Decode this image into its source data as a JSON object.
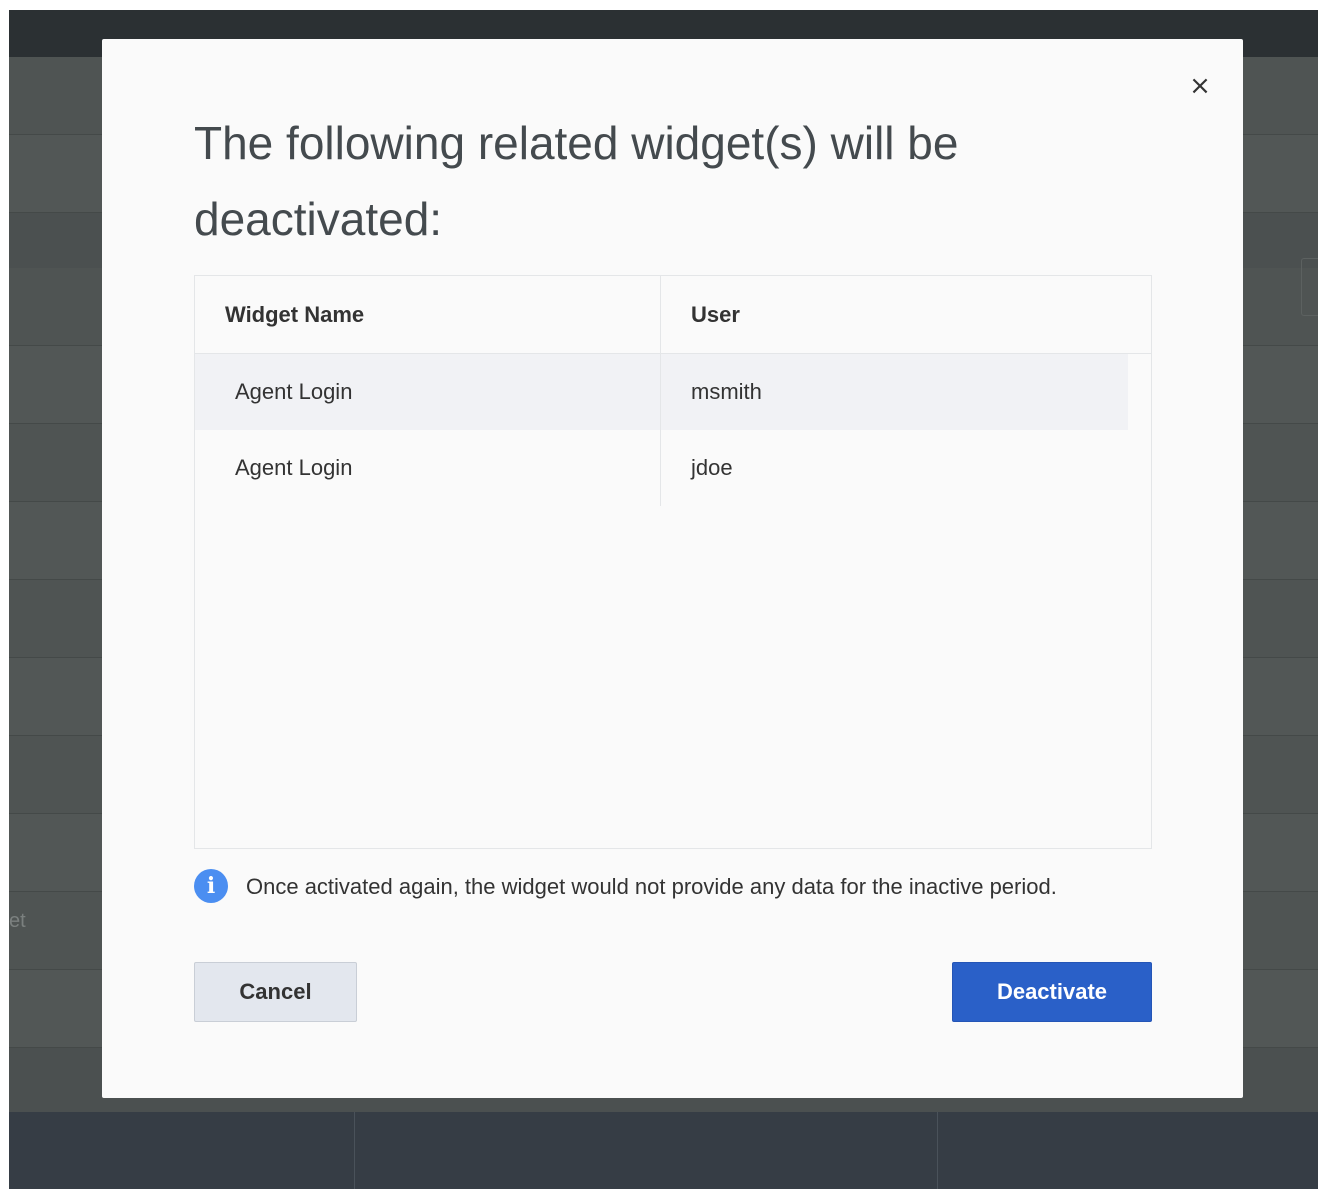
{
  "background": {
    "partial_label": "et"
  },
  "dialog": {
    "close_glyph": "×",
    "title": "The following related widget(s) will be deactivated:",
    "table": {
      "headers": [
        "Widget Name",
        "User"
      ],
      "rows": [
        [
          "Agent Login",
          "msmith"
        ],
        [
          "Agent Login",
          "jdoe"
        ]
      ]
    },
    "info_text": "Once activated again, the widget would not provide any data for the inactive period.",
    "cancel_label": "Cancel",
    "deactivate_label": "Deactivate"
  },
  "colors": {
    "primary_button": "#2a60c8",
    "info_icon": "#4b8ef1",
    "overlay": "#4b5050"
  }
}
